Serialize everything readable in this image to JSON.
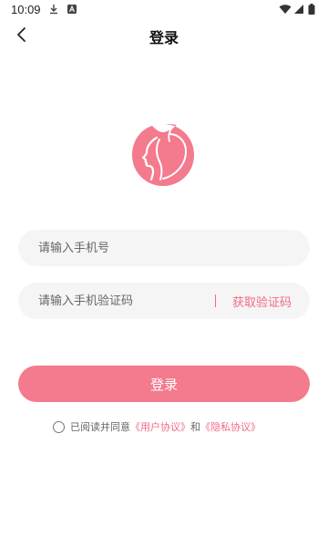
{
  "status_bar": {
    "time": "10:09",
    "icons": [
      "download-icon",
      "notification-a-icon",
      "wifi-icon",
      "signal-icon",
      "battery-icon"
    ]
  },
  "header": {
    "title": "登录",
    "back_icon": "chevron-left-icon"
  },
  "logo": {
    "icon": "woman-profile-logo",
    "color": "#f47a8d"
  },
  "form": {
    "phone_placeholder": "请输入手机号",
    "code_placeholder": "请输入手机验证码",
    "get_code_label": "获取验证码"
  },
  "login_button": {
    "label": "登录",
    "color": "#f47a8d"
  },
  "agreement": {
    "prefix": "已阅读并同意",
    "user_agreement": "《用户协议》",
    "and": "和",
    "privacy_policy": "《隐私协议》",
    "link_color": "#f16b86"
  }
}
